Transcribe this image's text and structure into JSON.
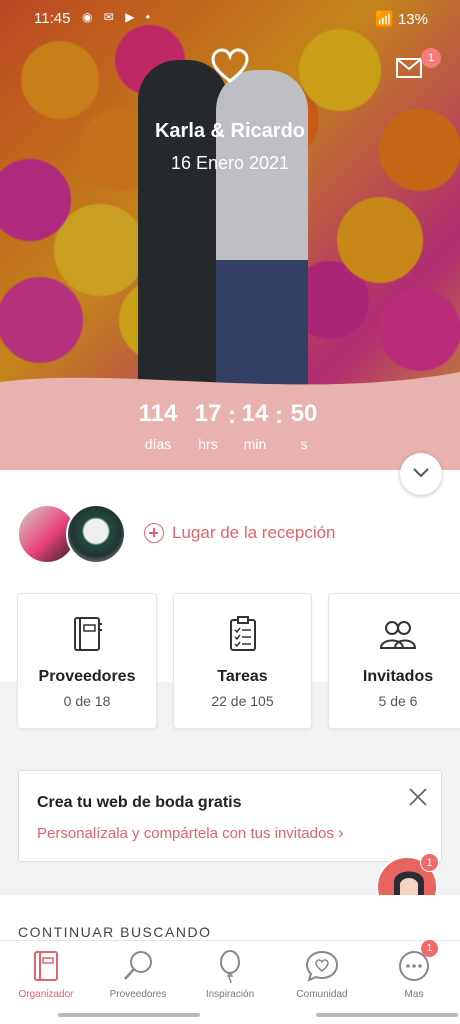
{
  "status_bar": {
    "time": "11:45",
    "battery": "13%"
  },
  "header": {
    "couple_names": "Karla & Ricardo",
    "wedding_date": "16 Enero 2021",
    "mail_badge": "1"
  },
  "countdown": [
    {
      "value": "114",
      "label": "días"
    },
    {
      "value": "17",
      "label": "hrs"
    },
    {
      "value": "14",
      "label": "min"
    },
    {
      "value": "50",
      "label": "s"
    }
  ],
  "reception": {
    "label": "Lugar de la recepción"
  },
  "cards": [
    {
      "title": "Proveedores",
      "sub": "0 de 18",
      "icon": "notebook-icon"
    },
    {
      "title": "Tareas",
      "sub": "22 de 105",
      "icon": "checklist-icon"
    },
    {
      "title": "Invitados",
      "sub": "5 de 6",
      "icon": "guests-icon"
    }
  ],
  "promo": {
    "title": "Crea tu web de boda gratis",
    "link": "Personalízala y compártela con tus invitados"
  },
  "assistant": {
    "badge": "1"
  },
  "section": {
    "title": "CONTINUAR BUSCANDO"
  },
  "tabbar": {
    "items": [
      {
        "label": "Organizador",
        "icon": "organizer-icon",
        "active": true
      },
      {
        "label": "Proveedores",
        "icon": "search-icon",
        "active": false
      },
      {
        "label": "Inspiración",
        "icon": "balloon-icon",
        "active": false
      },
      {
        "label": "Comunidad",
        "icon": "chat-heart-icon",
        "active": false
      },
      {
        "label": "Mas",
        "icon": "more-icon",
        "active": false
      }
    ],
    "more_badge": "1"
  },
  "colors": {
    "accent": "#e0656a",
    "band": "#e8b2ae"
  }
}
